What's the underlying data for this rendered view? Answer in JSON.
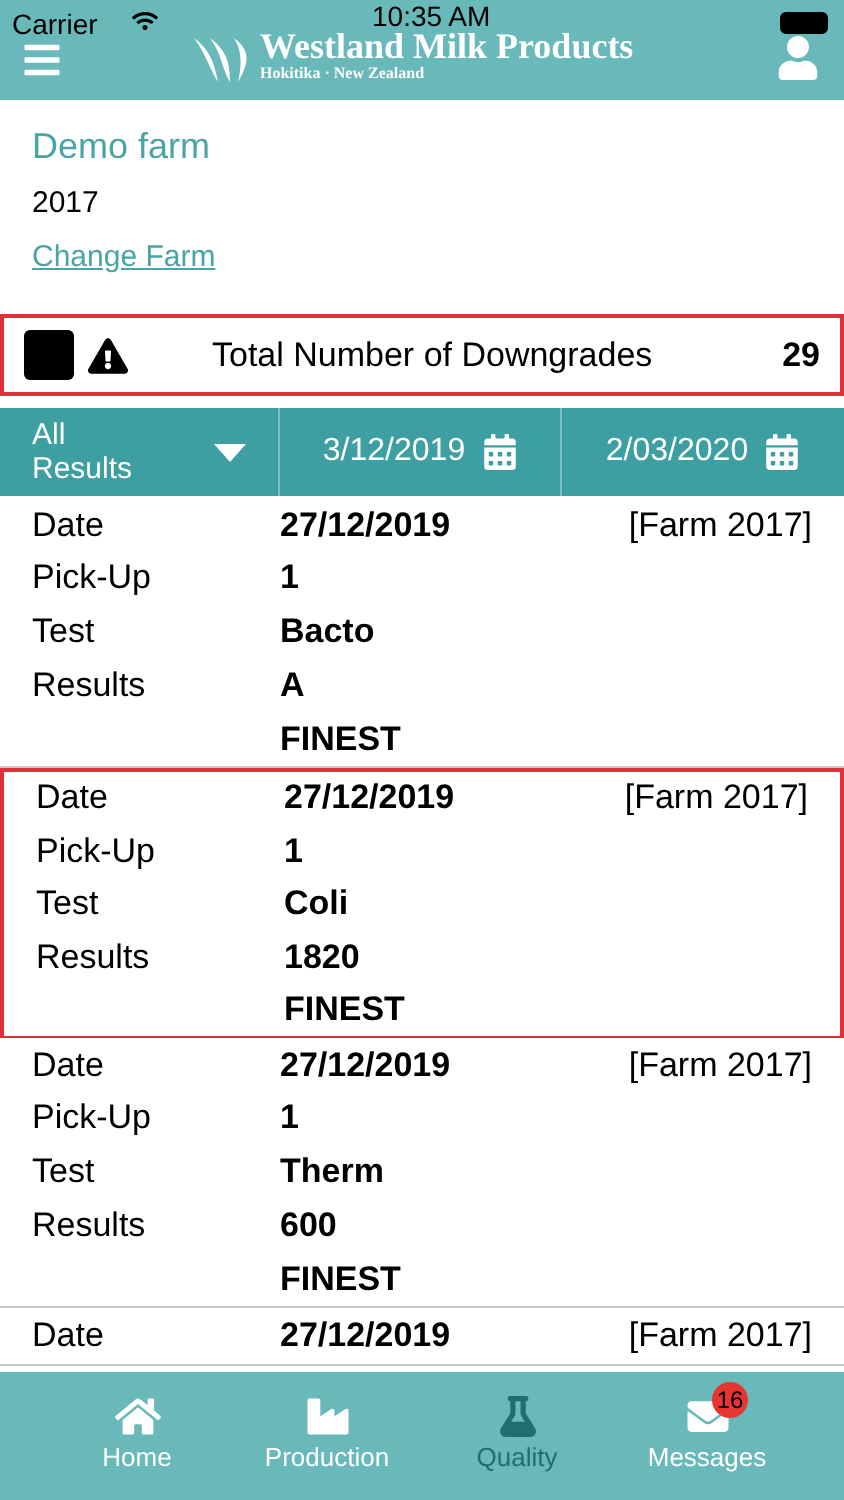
{
  "status_bar": {
    "carrier": "Carrier",
    "time": "10:35 AM"
  },
  "header": {
    "brand": "Westland Milk Products",
    "tagline": "Hokitika · New Zealand"
  },
  "farm": {
    "name": "Demo farm",
    "year": "2017",
    "change_link": "Change Farm"
  },
  "downgrades": {
    "checked": true,
    "label": "Total Number of Downgrades",
    "count": "29"
  },
  "filters": {
    "result_type": "All Results",
    "from_date": "3/12/2019",
    "to_date": "2/03/2020"
  },
  "records": [
    {
      "highlighted": false,
      "date_label": "Date",
      "date": "27/12/2019",
      "farm": "[Farm 2017]",
      "pickup_label": "Pick-Up",
      "pickup": "1",
      "test_label": "Test",
      "test": "Bacto",
      "results_label": "Results",
      "result": "A",
      "grade": "FINEST"
    },
    {
      "highlighted": true,
      "date_label": "Date",
      "date": "27/12/2019",
      "farm": "[Farm 2017]",
      "pickup_label": "Pick-Up",
      "pickup": "1",
      "test_label": "Test",
      "test": "Coli",
      "results_label": "Results",
      "result": "1820",
      "grade": "FINEST"
    },
    {
      "highlighted": false,
      "date_label": "Date",
      "date": "27/12/2019",
      "farm": "[Farm 2017]",
      "pickup_label": "Pick-Up",
      "pickup": "1",
      "test_label": "Test",
      "test": "Therm",
      "results_label": "Results",
      "result": "600",
      "grade": "FINEST"
    },
    {
      "highlighted": false,
      "date_label": "Date",
      "date": "27/12/2019",
      "farm": "[Farm 2017]"
    }
  ],
  "tabs": [
    {
      "kind": "home",
      "label": "Home",
      "selected": false
    },
    {
      "kind": "production",
      "label": "Production",
      "selected": false
    },
    {
      "kind": "quality",
      "label": "Quality",
      "selected": true
    },
    {
      "kind": "messages",
      "label": "Messages",
      "selected": false,
      "badge": "16"
    }
  ]
}
